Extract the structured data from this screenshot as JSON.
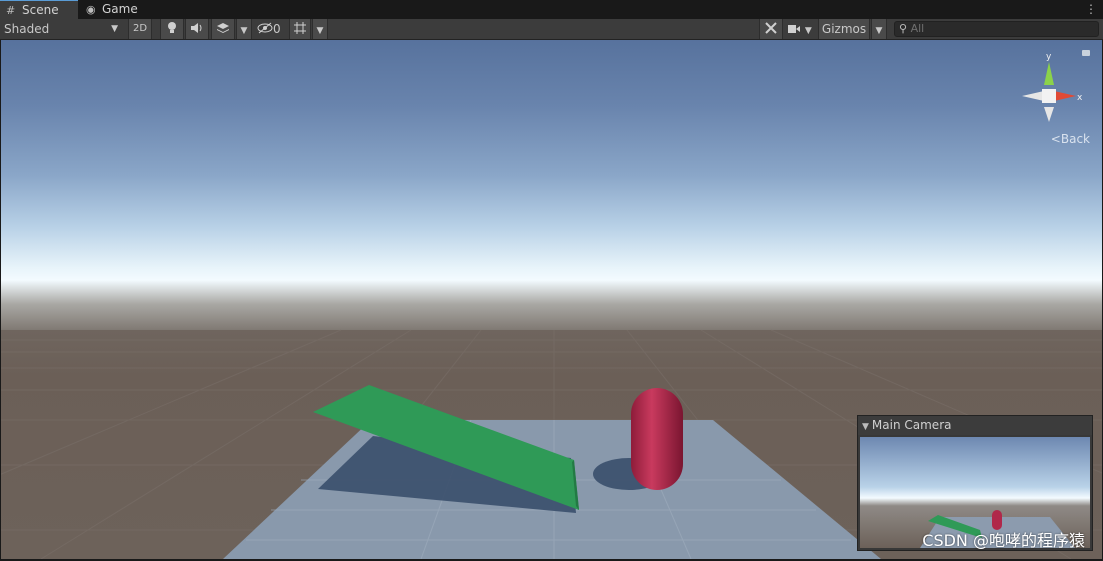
{
  "tabs": [
    {
      "label": "Scene",
      "icon": "grid-icon",
      "active": true
    },
    {
      "label": "Game",
      "icon": "gamepad-icon",
      "active": false
    }
  ],
  "toolbar": {
    "shading_mode": "Shaded",
    "mode_2d": "2D",
    "hidden_count": "0",
    "gizmos_label": "Gizmos",
    "search_placeholder": "All"
  },
  "scene": {
    "orientation_label": "Back",
    "gizmo_axes": {
      "y": "y",
      "x": "x"
    }
  },
  "camera_preview": {
    "title": "Main Camera"
  },
  "watermark": "CSDN @咆哮的程序猿",
  "colors": {
    "sky_top": "#57729d",
    "horizon": "#f3fbff",
    "ground": "#6d625a",
    "plane": "#8898ab",
    "ramp": "#2f9a57",
    "capsule": "#b0284a"
  }
}
